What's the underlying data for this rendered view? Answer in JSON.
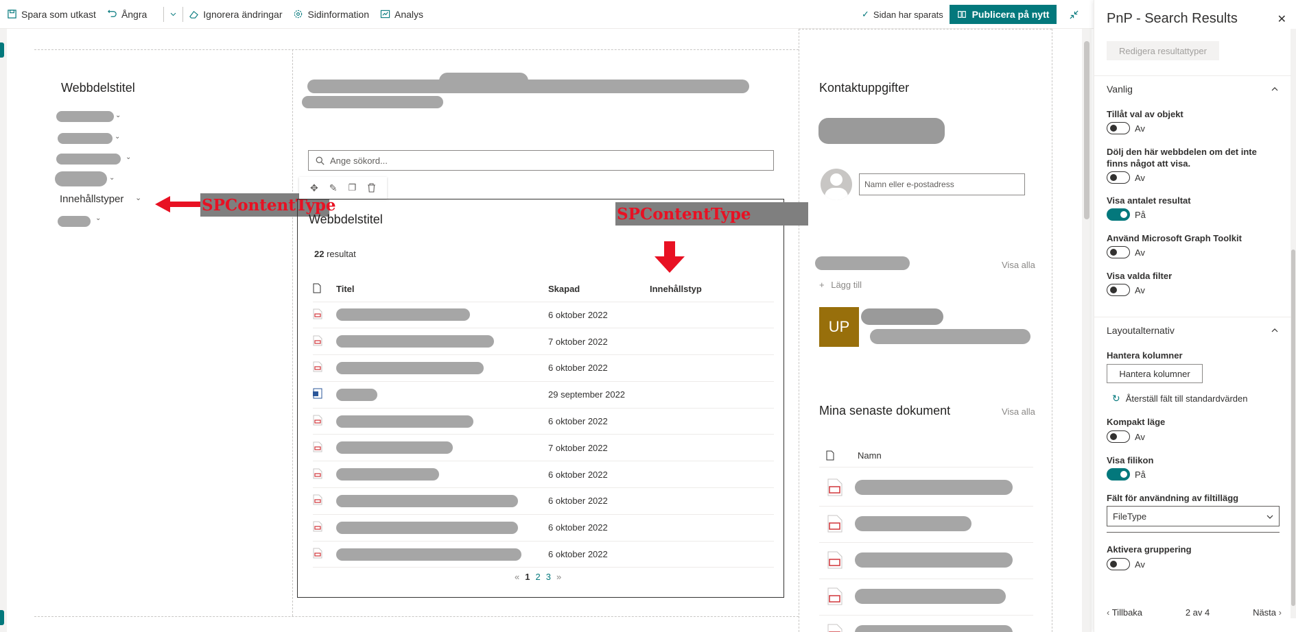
{
  "toolbar": {
    "save_draft": "Spara som utkast",
    "undo": "Ångra",
    "discard": "Ignorera ändringar",
    "page_details": "Sidinformation",
    "analytics": "Analys",
    "saved_status": "Sidan har sparats",
    "publish": "Publicera på nytt"
  },
  "left_webpart": {
    "title": "Webbdelstitel",
    "refiner_content_type": "Innehållstyper"
  },
  "annotations": {
    "left": "SPContentType",
    "right": "SPContentType"
  },
  "search": {
    "placeholder": "Ange sökord..."
  },
  "results_webpart": {
    "title": "Webbdelstitel",
    "count_number": "22",
    "count_word": "resultat",
    "columns": {
      "title": "Titel",
      "created": "Skapad",
      "content_type": "Innehållstyp"
    },
    "rows": [
      {
        "created": "6 oktober 2022"
      },
      {
        "created": "7 oktober 2022"
      },
      {
        "created": "6 oktober 2022"
      },
      {
        "created": "29 september 2022"
      },
      {
        "created": "6 oktober 2022"
      },
      {
        "created": "7 oktober 2022"
      },
      {
        "created": "6 oktober 2022"
      },
      {
        "created": "6 oktober 2022"
      },
      {
        "created": "6 oktober 2022"
      },
      {
        "created": "6 oktober 2022"
      }
    ],
    "pager": {
      "prev": "«",
      "p1": "1",
      "p2": "2",
      "p3": "3",
      "next": "»"
    }
  },
  "right_column": {
    "contact_title": "Kontaktuppgifter",
    "people_placeholder": "Namn eller e-postadress",
    "links_view_all": "Visa alla",
    "add": "Lägg till",
    "initials": "UP",
    "recent_docs_title": "Mina senaste dokument",
    "recent_view_all": "Visa alla",
    "name_column": "Namn"
  },
  "pane": {
    "title": "PnP - Search Results",
    "edit_result_types": "Redigera resultattyper",
    "section_common": "Vanlig",
    "allow_select": "Tillåt val av objekt",
    "allow_select_state": "Av",
    "hide_if_empty": "Dölj den här webbdelen om det inte finns något att visa.",
    "hide_if_empty_state": "Av",
    "show_count": "Visa antalet resultat",
    "show_count_state": "På",
    "use_mgt": "Använd Microsoft Graph Toolkit",
    "use_mgt_state": "Av",
    "show_filters": "Visa valda filter",
    "show_filters_state": "Av",
    "section_layout": "Layoutalternativ",
    "manage_columns_label": "Hantera kolumner",
    "manage_columns_button": "Hantera kolumner",
    "reset_fields": "Återställ fält till standardvärden",
    "compact": "Kompakt läge",
    "compact_state": "Av",
    "file_icon": "Visa filikon",
    "file_icon_state": "På",
    "file_ext_field": "Fält för användning av filtillägg",
    "file_ext_value": "FileType",
    "grouping": "Aktivera gruppering",
    "grouping_state": "Av",
    "back": "Tillbaka",
    "page_of": "2 av 4",
    "next": "Nästa"
  },
  "colors": {
    "accent": "#03787c",
    "annotation_red": "#e81123",
    "initials_tile": "#986f0b"
  }
}
